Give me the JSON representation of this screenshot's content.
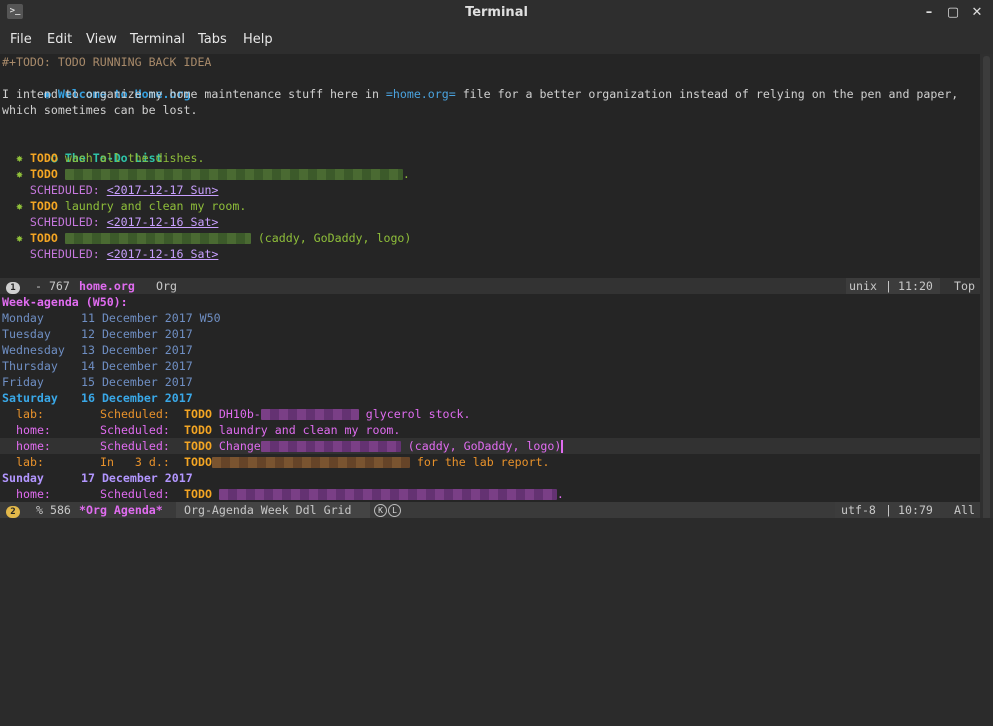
{
  "window": {
    "title": "Terminal",
    "app_icon": ">_",
    "controls": {
      "minimize": "–",
      "maximize": "▢",
      "close": "✕"
    }
  },
  "menu": [
    "File",
    "Edit",
    "View",
    "Terminal",
    "Tabs",
    "Help"
  ],
  "org": {
    "todo_keyword_line": "#+TODO: TODO RUNNING BACK IDEA",
    "h1_bullet": "◉",
    "h1": "Welcome to Home.org",
    "para_1a": "I intend to organize my home maintenance stuff here in ",
    "para_1_link": "=home.org=",
    "para_1b": " file for a better organization instead of relying on the pen and paper,",
    "para_2": "which sometimes can be lost.",
    "h2_bullet": "○",
    "h2": "The To-Do List",
    "items": [
      {
        "bullet": "✸",
        "kw": "TODO",
        "text": "wash all the dishes."
      },
      {
        "bullet": "✸",
        "kw": "TODO",
        "text": ".",
        "scheduled_label": "SCHEDULED:",
        "date": "<2017-12-17 Sun>"
      },
      {
        "bullet": "✸",
        "kw": "TODO",
        "text": "laundry and clean my room.",
        "scheduled_label": "SCHEDULED:",
        "date": "<2017-12-16 Sat>"
      },
      {
        "bullet": "✸",
        "kw": "TODO",
        "text": "(caddy, GoDaddy, logo)",
        "scheduled_label": "SCHEDULED:",
        "date": "<2017-12-16 Sat>"
      }
    ]
  },
  "modeline_top": {
    "badge": "1",
    "state": " - 767",
    "buffer": "home.org",
    "mode": "Org",
    "encoding": "unix",
    "sep": "|",
    "position": "11:20",
    "scroll": "Top"
  },
  "agenda": {
    "header": "Week-agenda (W50):",
    "days": [
      {
        "name": "Monday",
        "date": "11 December 2017",
        "week": "W50"
      },
      {
        "name": "Tuesday",
        "date": "12 December 2017"
      },
      {
        "name": "Wednesday",
        "date": "13 December 2017"
      },
      {
        "name": "Thursday",
        "date": "14 December 2017"
      },
      {
        "name": "Friday",
        "date": "15 December 2017"
      },
      {
        "name": "Saturday",
        "date": "16 December 2017"
      },
      {
        "name": "Sunday",
        "date": "17 December 2017"
      }
    ],
    "entries": [
      {
        "cat": "lab:",
        "when": "Scheduled:",
        "kw": "TODO",
        "pre": "DH10b-",
        "post": "glycerol stock."
      },
      {
        "cat": "home:",
        "when": "Scheduled:",
        "kw": "TODO",
        "pre": "laundry and clean my room.",
        "post": ""
      },
      {
        "cat": "home:",
        "when": "Scheduled:",
        "kw": "TODO",
        "pre": "Change",
        "post": "(caddy, GoDaddy, logo)"
      },
      {
        "cat": "lab:",
        "when": "In   3 d.:",
        "kw": "TODO",
        "pre": "",
        "post": "for the lab report."
      },
      {
        "cat": "home:",
        "when": "Scheduled:",
        "kw": "TODO",
        "pre": "",
        "post": "."
      }
    ]
  },
  "modeline_bottom": {
    "badge": "2",
    "state": "% 586",
    "buffer": "*Org Agenda*",
    "mode": "Org-Agenda Week Ddl Grid",
    "flag_k": "K",
    "flag_l": "L",
    "encoding": "utf-8",
    "sep": "|",
    "position": "10:79",
    "scroll": "All"
  },
  "colors": {
    "todo": "#f5a623",
    "heading_blue": "#35a0e0",
    "heading_teal": "#2ec4a8",
    "agenda_magenta": "#e06cf0"
  }
}
